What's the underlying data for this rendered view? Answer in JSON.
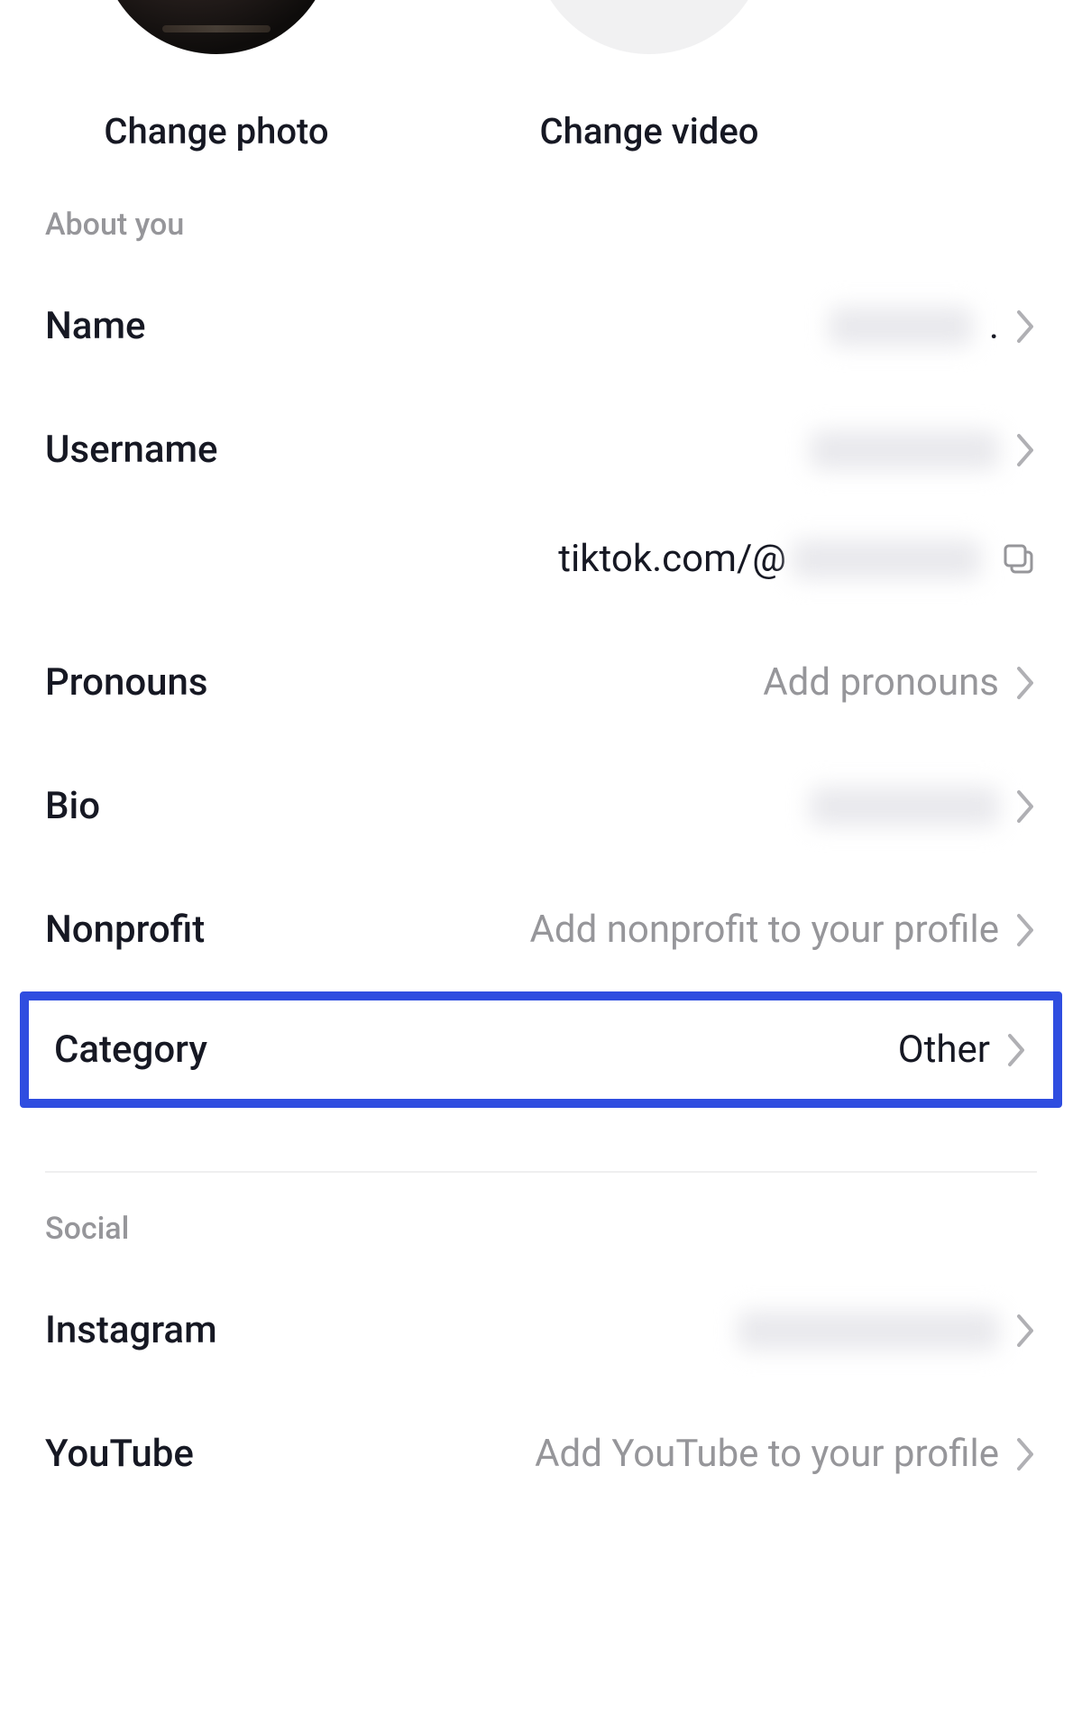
{
  "media": {
    "change_photo_label": "Change photo",
    "change_video_label": "Change video"
  },
  "sections": {
    "about_you": "About you",
    "social": "Social"
  },
  "rows": {
    "name": {
      "label": "Name",
      "value": ""
    },
    "username": {
      "label": "Username",
      "value": ""
    },
    "profile_url_prefix": "tiktok.com/@",
    "pronouns": {
      "label": "Pronouns",
      "placeholder": "Add pronouns"
    },
    "bio": {
      "label": "Bio",
      "value": ""
    },
    "nonprofit": {
      "label": "Nonprofit",
      "placeholder": "Add nonprofit to your profile"
    },
    "category": {
      "label": "Category",
      "value": "Other"
    },
    "instagram": {
      "label": "Instagram",
      "value": ""
    },
    "youtube": {
      "label": "YouTube",
      "placeholder": "Add YouTube to your profile"
    }
  },
  "icons": {
    "chevron_right": "chevron-right-icon",
    "copy": "copy-icon"
  },
  "highlight": "category"
}
